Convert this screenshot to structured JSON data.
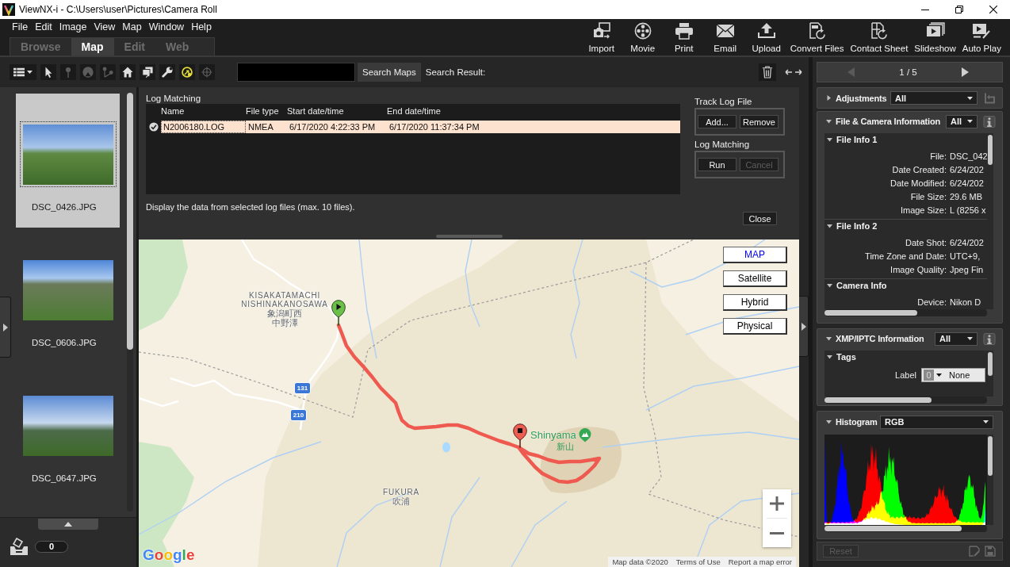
{
  "window": {
    "title": "ViewNX-i - C:\\Users\\user\\Pictures\\Camera Roll"
  },
  "menu": [
    "File",
    "Edit",
    "Image",
    "View",
    "Map",
    "Window",
    "Help"
  ],
  "mode_tabs": [
    {
      "label": "Browse",
      "selected": false
    },
    {
      "label": "Map",
      "selected": true
    },
    {
      "label": "Edit",
      "selected": false
    },
    {
      "label": "Web",
      "selected": false
    }
  ],
  "actions": [
    {
      "kind": "import",
      "label": "Import"
    },
    {
      "kind": "movie",
      "label": "Movie"
    },
    {
      "kind": "print",
      "label": "Print"
    },
    {
      "kind": "email",
      "label": "Email"
    },
    {
      "kind": "upload",
      "label": "Upload"
    },
    {
      "kind": "convert",
      "label": "Convert Files"
    },
    {
      "kind": "contact_sheet",
      "label": "Contact Sheet"
    },
    {
      "kind": "slideshow",
      "label": "Slideshow"
    },
    {
      "kind": "auto_play",
      "label": "Auto Play"
    }
  ],
  "map_toolbar": {
    "tools": [
      {
        "kind": "view",
        "disabled": false,
        "on": false
      },
      {
        "kind": "pointer",
        "disabled": false,
        "on": false
      },
      {
        "kind": "pin",
        "disabled": true,
        "on": false
      },
      {
        "kind": "compass",
        "disabled": true,
        "on": false
      },
      {
        "kind": "route",
        "disabled": true,
        "on": false
      },
      {
        "kind": "home",
        "disabled": false,
        "on": false
      },
      {
        "kind": "windows",
        "disabled": false,
        "on": false
      },
      {
        "kind": "wrench",
        "disabled": false,
        "on": false
      },
      {
        "kind": "track",
        "disabled": false,
        "on": true
      },
      {
        "kind": "crosshair",
        "disabled": true,
        "on": false
      }
    ],
    "search_button": "Search Maps",
    "search_result_label": "Search Result:"
  },
  "viewer_nav": {
    "prev_disabled": true,
    "page": "1 / 5",
    "next_disabled": false
  },
  "thumbnails": [
    {
      "file": "DSC_0426.JPG",
      "selected": true
    },
    {
      "file": "DSC_0606.JPG",
      "selected": false
    },
    {
      "file": "DSC_0647.JPG",
      "selected": false
    }
  ],
  "tray": {
    "count": "0"
  },
  "log_matching": {
    "title": "Log Matching",
    "columns": [
      "Name",
      "File type",
      "Start date/time",
      "End date/time"
    ],
    "rows": [
      {
        "checked": true,
        "selected": true,
        "cells": [
          "N2006180.LOG",
          "NMEA",
          "6/17/2020 4:22:33 PM",
          "6/17/2020 11:37:34 PM"
        ]
      }
    ],
    "hint": "Display the data from selected log files (max. 10 files).",
    "groups": [
      {
        "title": "Track Log File",
        "buttons": [
          {
            "label": "Add...",
            "disabled": false
          },
          {
            "label": "Remove",
            "disabled": false
          }
        ]
      },
      {
        "title": "Log Matching",
        "buttons": [
          {
            "label": "Run",
            "disabled": false
          },
          {
            "label": "Cancel",
            "disabled": true
          }
        ]
      }
    ],
    "close_button": "Close"
  },
  "map": {
    "types": [
      {
        "label": "MAP",
        "selected": true
      },
      {
        "label": "Satellite",
        "selected": false
      },
      {
        "label": "Hybrid",
        "selected": false
      },
      {
        "label": "Physical",
        "selected": false
      }
    ],
    "places": [
      {
        "lines": [
          "KISAKATAMACHI",
          "NISHINAKANOSAWA"
        ],
        "native_lines": [
          "象潟町西",
          "中野澤"
        ]
      },
      {
        "lines": [
          "FUKURA"
        ],
        "native_lines": [
          "吹浦"
        ]
      }
    ],
    "road_numbers": [
      "131",
      "210"
    ],
    "summit": {
      "name": "Shinyama",
      "native_name": "新山"
    },
    "logo": "Google",
    "attribution": [
      "Map data ©2020",
      "Terms of Use",
      "Report a map error"
    ]
  },
  "panels": {
    "adjustments": {
      "title": "Adjustments",
      "expanded": false,
      "filter": "All"
    },
    "file_info": {
      "title": "File & Camera Information",
      "expanded": true,
      "filter": "All",
      "groups": [
        {
          "title": "File Info 1",
          "expanded": true,
          "fields": [
            {
              "label": "File:",
              "value": "DSC_042"
            },
            {
              "label": "Date Created:",
              "value": "6/24/202"
            },
            {
              "label": "Date Modified:",
              "value": "6/24/202"
            },
            {
              "label": "File Size:",
              "value": "29.6 MB"
            },
            {
              "label": "Image Size:",
              "value": "L (8256 x"
            }
          ]
        },
        {
          "title": "File Info 2",
          "expanded": true,
          "fields": [
            {
              "label": "Date Shot:",
              "value": "6/24/202"
            },
            {
              "label": "Time Zone and Date:",
              "value": "UTC+9,"
            },
            {
              "label": "Image Quality:",
              "value": "Jpeg Fin"
            }
          ]
        },
        {
          "title": "Camera Info",
          "expanded": true,
          "fields": [
            {
              "label": "Device:",
              "value": "Nikon D"
            }
          ]
        }
      ]
    },
    "xmp": {
      "title": "XMP/IPTC Information",
      "expanded": true,
      "filter": "All",
      "groups": [
        {
          "title": "Tags",
          "expanded": true,
          "fields": [
            {
              "kind": "select",
              "label": "Label",
              "badge": "0",
              "value": "None"
            }
          ]
        }
      ]
    },
    "histogram": {
      "title": "Histogram",
      "expanded": true,
      "channel": "RGB"
    },
    "reset": {
      "label": "Reset",
      "disabled": true
    }
  }
}
